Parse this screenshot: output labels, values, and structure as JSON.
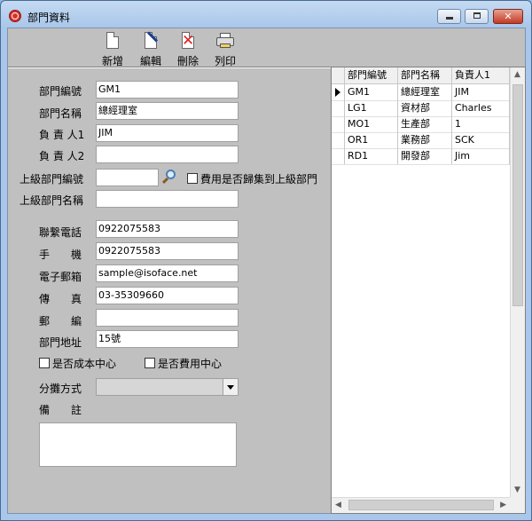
{
  "window": {
    "title": "部門資料"
  },
  "toolbar": [
    {
      "label": "新增",
      "icon": "new-document-icon"
    },
    {
      "label": "編輯",
      "icon": "edit-icon"
    },
    {
      "label": "刪除",
      "icon": "delete-icon"
    },
    {
      "label": "列印",
      "icon": "print-icon"
    }
  ],
  "form": {
    "dept_code_label": "部門編號",
    "dept_code": "GM1",
    "dept_name_label": "部門名稱",
    "dept_name": "總經理室",
    "manager1_label": "負 責 人1",
    "manager1": "JIM",
    "manager2_label": "負 責 人2",
    "manager2": "",
    "parent_code_label": "上級部門編號",
    "parent_code": "",
    "aggregate_label": "費用是否歸集到上級部門",
    "parent_name_label": "上級部門名稱",
    "parent_name": "",
    "phone_label": "聯繫電話",
    "phone": "0922075583",
    "mobile_label": "手　　機",
    "mobile": "0922075583",
    "email_label": "電子郵箱",
    "email": "sample@isoface.net",
    "fax_label": "傳　　真",
    "fax": "03-35309660",
    "zip_label": "郵　　編",
    "zip": "",
    "address_label": "部門地址",
    "address": "15號",
    "cost_center_label": "是否成本中心",
    "expense_center_label": "是否費用中心",
    "allocation_label": "分攤方式",
    "allocation": "",
    "remark_label": "備　　註",
    "remark": ""
  },
  "grid": {
    "columns": [
      "部門編號",
      "部門名稱",
      "負責人1"
    ],
    "rows": [
      [
        "GM1",
        "總經理室",
        "JIM"
      ],
      [
        "LG1",
        "資材部",
        "Charles"
      ],
      [
        "MO1",
        "生產部",
        "1"
      ],
      [
        "OR1",
        "業務部",
        "SCK"
      ],
      [
        "RD1",
        "開發部",
        "Jim"
      ]
    ],
    "current_row": 0
  }
}
